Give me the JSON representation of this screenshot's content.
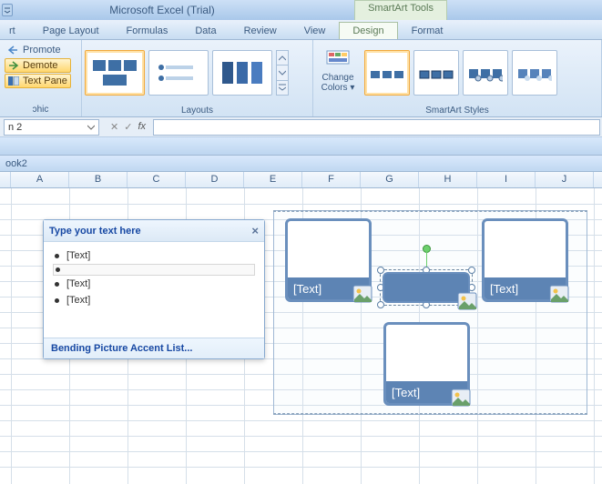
{
  "app_title": "Microsoft Excel (Trial)",
  "contextual_title": "SmartArt Tools",
  "tabs": {
    "t0": "rt",
    "t1": "Page Layout",
    "t2": "Formulas",
    "t3": "Data",
    "t4": "Review",
    "t5": "View",
    "t6": "Design",
    "t7": "Format"
  },
  "ribbon": {
    "promote": "Promote",
    "demote": "Demote",
    "textpane": "Text Pane",
    "graphic_group": "ɔhic",
    "layouts_group": "Layouts",
    "change_colors": "Change Colors",
    "styles_group": "SmartArt Styles"
  },
  "namebox": "n 2",
  "fx": "fx",
  "workbook": "ook2",
  "columns": {
    "a": "A",
    "b": "B",
    "c": "C",
    "d": "D",
    "e": "E",
    "f": "F",
    "g": "G",
    "h": "H",
    "i": "I",
    "j": "J"
  },
  "textpane": {
    "title": "Type your text here",
    "items": {
      "i0": "[Text]",
      "i2": "[Text]",
      "i3": "[Text]"
    },
    "footer": "Bending Picture Accent List..."
  },
  "smartart": {
    "caption": "[Text]"
  }
}
